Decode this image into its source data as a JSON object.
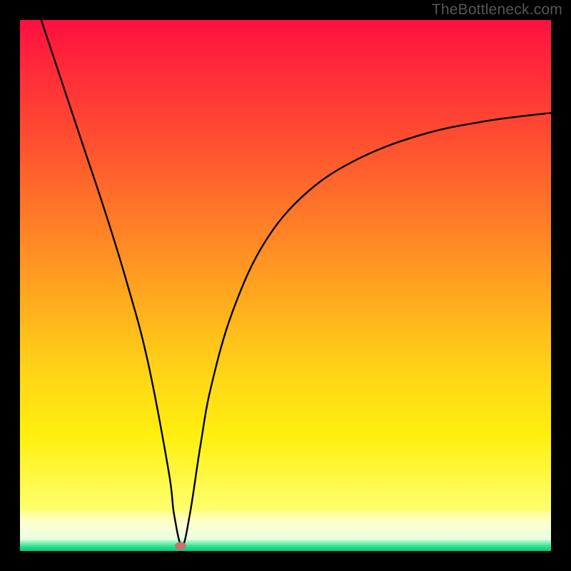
{
  "watermark": "TheBottleneck.com",
  "chart_data": {
    "type": "line",
    "title": "",
    "xlabel": "",
    "ylabel": "",
    "xlim": [
      0,
      100
    ],
    "ylim": [
      0,
      100
    ],
    "background_zones": [
      {
        "from_pct": 0,
        "to_pct": 92.5,
        "colors": [
          "#ff1040",
          "#ffff70"
        ],
        "name": "red-yellow-gradient"
      },
      {
        "from_pct": 92.5,
        "to_pct": 97.8,
        "colors": [
          "#ffff90",
          "#e8ffe0"
        ],
        "name": "pale-transition"
      },
      {
        "from_pct": 97.8,
        "to_pct": 100,
        "colors": [
          "#d0ffd8",
          "#00cc70"
        ],
        "name": "green-band"
      }
    ],
    "series": [
      {
        "name": "bottleneck-curve",
        "x": [
          4.0,
          8.0,
          12.0,
          16.0,
          20.0,
          24.0,
          28.0,
          29.0,
          30.5,
          32.0,
          34.0,
          36.0,
          40.0,
          46.0,
          54.0,
          64.0,
          76.0,
          88.0,
          100.0
        ],
        "values": [
          100.0,
          88.0,
          76.0,
          64.0,
          51.0,
          36.0,
          15.0,
          7.0,
          1.0,
          7.0,
          20.0,
          31.0,
          45.0,
          58.0,
          67.5,
          74.0,
          78.5,
          81.0,
          82.5
        ]
      }
    ],
    "marker": {
      "x": 30.3,
      "y": 1.0,
      "color": "#cc6f6f"
    }
  }
}
